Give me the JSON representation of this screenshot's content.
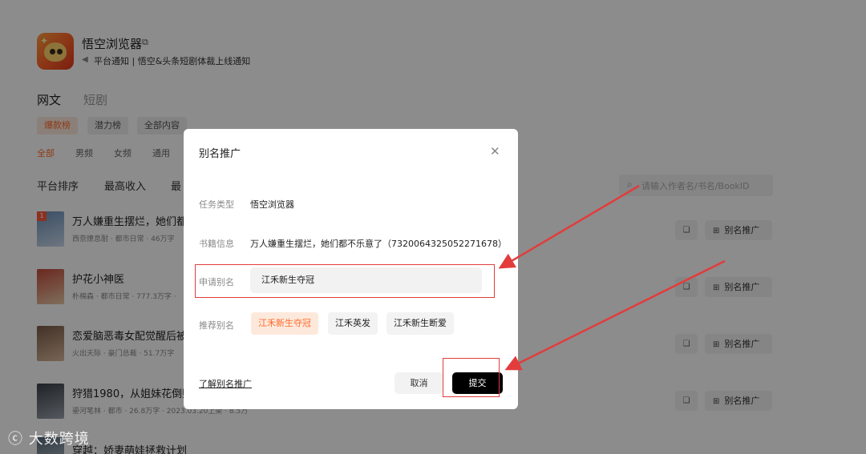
{
  "app": {
    "name": "悟空浏览器",
    "notice": "平台通知 | 悟空&头条短剧体裁上线通知"
  },
  "main_tabs": [
    "网文",
    "短剧"
  ],
  "ranking_chips": [
    "爆款榜",
    "潜力榜",
    "全部内容"
  ],
  "categories": [
    "全部",
    "男频",
    "女频",
    "通用"
  ],
  "sort_options": [
    "平台排序",
    "最高收入",
    "最"
  ],
  "search": {
    "placeholder": "请输入作者名/书名/BookID"
  },
  "books": [
    {
      "title": "万人嫌重生摆烂，她们都",
      "meta": "西奈燎息耐 · 都市日常 · 46万字",
      "rank": "1"
    },
    {
      "title": "护花小神医",
      "meta": "朴棉森 · 都市日常 · 777.3万字 ·",
      "rank": ""
    },
    {
      "title": "恋爱脑恶毒女配觉醒后被",
      "meta": "火出天际 · 豪门总裁 · 51.7万字",
      "rank": ""
    },
    {
      "title": "狩猎1980，从姐妹花倒贴",
      "meta": "鎏河笔林 · 都市 · 26.8万字 · 2023.03.20上架 · 8.5万",
      "rank": ""
    },
    {
      "title": "穿越：娇妻萌娃拯救计划",
      "meta": "",
      "rank": ""
    }
  ],
  "row_actions": {
    "alias_button": "别名推广"
  },
  "modal": {
    "title": "别名推广",
    "task_type_label": "任务类型",
    "task_type_value": "悟空浏览器",
    "book_info_label": "书籍信息",
    "book_info_value": "万人嫌重生摆烂，她们都不乐意了（7320064325052271678）",
    "apply_alias_label": "申请别名",
    "apply_alias_value": "江禾新生夺冠",
    "suggest_label": "推荐别名",
    "suggestions": [
      "江禾新生夺冠",
      "江禾英发",
      "江禾新生断爱"
    ],
    "learn_link": "了解别名推广",
    "cancel": "取消",
    "submit": "提交"
  },
  "watermark": "大数跨境",
  "colors": {
    "accent": "#ff6b2b",
    "annotation": "#e23c3c",
    "primary_button": "#000000"
  }
}
